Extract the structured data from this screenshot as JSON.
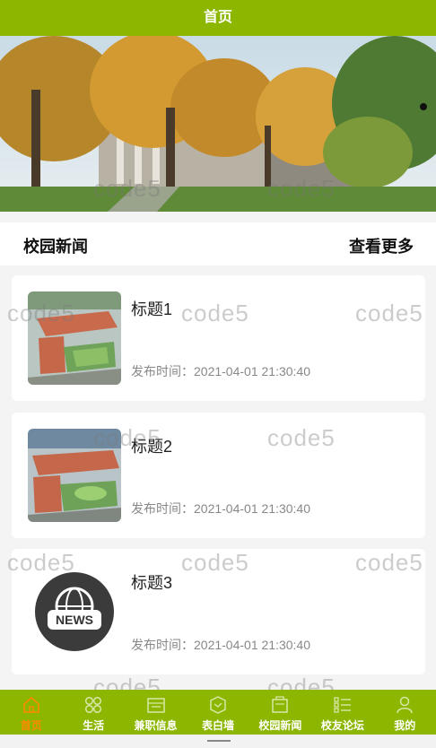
{
  "header": {
    "title": "首页"
  },
  "section": {
    "title": "校园新闻",
    "more": "查看更多"
  },
  "news": [
    {
      "title": "标题1",
      "time": "发布时间：2021-04-01 21:30:40"
    },
    {
      "title": "标题2",
      "time": "发布时间：2021-04-01 21:30:40"
    },
    {
      "title": "标题3",
      "time": "发布时间：2021-04-01 21:30:40"
    }
  ],
  "news_logo_text": "NEWS",
  "tabs": [
    {
      "label": "首页",
      "icon": "home-icon"
    },
    {
      "label": "生活",
      "icon": "grid-icon"
    },
    {
      "label": "兼职信息",
      "icon": "briefcase-icon"
    },
    {
      "label": "表白墙",
      "icon": "heart-box-icon"
    },
    {
      "label": "校园新闻",
      "icon": "newspaper-icon"
    },
    {
      "label": "校友论坛",
      "icon": "list-icon"
    },
    {
      "label": "我的",
      "icon": "user-icon"
    }
  ],
  "watermark": "code5",
  "colors": {
    "primary": "#8db600",
    "active_tab": "#ff8a00"
  }
}
